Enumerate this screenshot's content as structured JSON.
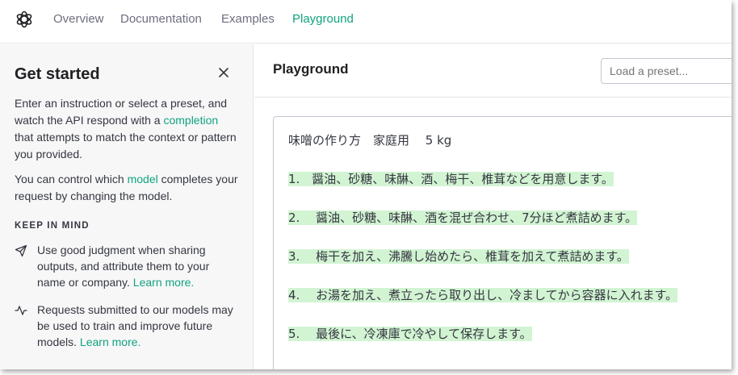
{
  "nav": {
    "links": [
      "Overview",
      "Documentation",
      "Examples",
      "Playground"
    ],
    "active": "Playground"
  },
  "sidebar": {
    "title": "Get started",
    "intro_1": "Enter an instruction or select a preset, and watch the API respond with a",
    "intro_link": "completion",
    "intro_2": "that attempts to match the context or pattern you provided.",
    "model_1": "You can control which",
    "model_link": "model",
    "model_2": "completes your request by changing the model.",
    "keep_in_mind": "KEEP IN MIND",
    "tips": [
      {
        "icon": "send-icon",
        "text": "Use good judgment when sharing outputs, and attribute them to your name or company.",
        "link": "Learn more."
      },
      {
        "icon": "activity-icon",
        "text": "Requests submitted to our models may be used to train and improve future models.",
        "link": "Learn more."
      }
    ]
  },
  "main": {
    "title": "Playground",
    "preset_placeholder": "Load a preset...",
    "prompt": "味噌の作り方　家庭用　 5 kg",
    "completion": [
      "1.　醤油、砂糖、味醂、酒、梅干、椎茸などを用意します。",
      "2.　 醤油、砂糖、味醂、酒を混ぜ合わせ、7分ほど煮詰めます。",
      "3.　 梅干を加え、沸騰し始めたら、椎茸を加えて煮詰めます。",
      "4.　 お湯を加え、煮立ったら取り出し、冷ましてから容器に入れます。",
      "5.　 最後に、冷凍庫で冷やして保存します。"
    ]
  },
  "colors": {
    "accent": "#10a37f",
    "completion_highlight": "#d2f4d3"
  }
}
